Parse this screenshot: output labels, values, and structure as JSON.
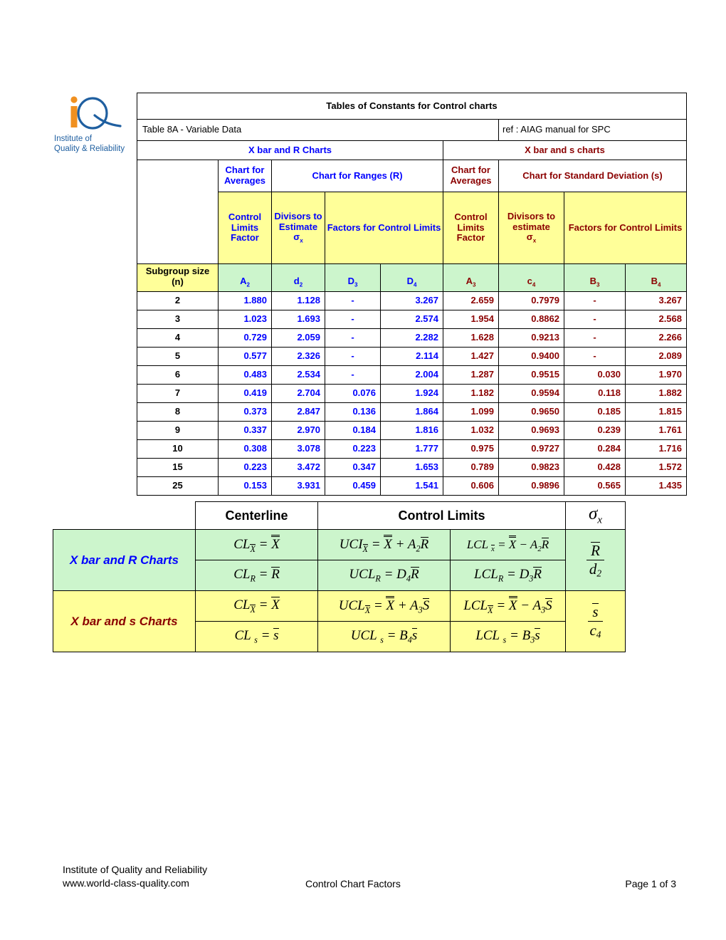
{
  "logo": {
    "caption_line1": "Institute of",
    "caption_line2": "Quality & Reliability",
    "mark_letters": "iQ",
    "color_orange": "#F09020",
    "color_blue": "#1F5FA0"
  },
  "header": {
    "title": "Tables of Constants for Control charts",
    "subtitle": "Table 8A - Variable Data",
    "reference": "ref : AIAG manual for SPC",
    "group_left": "X bar and R Charts",
    "group_right": "X bar and s charts",
    "color_blue": "#0000FF",
    "color_red": "#8B0000",
    "bg_yellow": "#FFFF99",
    "bg_green": "#CCF5CC"
  },
  "columns": {
    "chart_for_averages_left": "Chart for Averages",
    "chart_for_ranges": "Chart for Ranges (R)",
    "chart_for_averages_right": "Chart for Averages",
    "chart_for_std_dev": "Chart for Standard Deviation (s)",
    "desc_a2": "Control Limits Factor",
    "desc_d2": "Divisors to Estimate",
    "desc_d2_sigma": "σx",
    "desc_d3d4": "Factors for Control Limits",
    "desc_a3": "Control Limits Factor",
    "desc_c4": "Divisors to estimate",
    "desc_c4_sigma": "σx",
    "desc_b3b4": "Factors for Control Limits",
    "subgroup_label_line1": "Subgroup size",
    "subgroup_label_line2": "(n)",
    "symbols": [
      "A2",
      "d2",
      "D3",
      "D4",
      "A3",
      "c4",
      "B3",
      "B4"
    ]
  },
  "table_data": {
    "headers": [
      "Subgroup size (n)",
      "A2",
      "d2",
      "D3",
      "D4",
      "A3",
      "c4",
      "B3",
      "B4"
    ],
    "rows": [
      {
        "n": "2",
        "A2": "1.880",
        "d2": "1.128",
        "D3": "-",
        "D4": "3.267",
        "A3": "2.659",
        "c4": "0.7979",
        "B3": "-",
        "B4": "3.267"
      },
      {
        "n": "3",
        "A2": "1.023",
        "d2": "1.693",
        "D3": "-",
        "D4": "2.574",
        "A3": "1.954",
        "c4": "0.8862",
        "B3": "-",
        "B4": "2.568"
      },
      {
        "n": "4",
        "A2": "0.729",
        "d2": "2.059",
        "D3": "-",
        "D4": "2.282",
        "A3": "1.628",
        "c4": "0.9213",
        "B3": "-",
        "B4": "2.266"
      },
      {
        "n": "5",
        "A2": "0.577",
        "d2": "2.326",
        "D3": "-",
        "D4": "2.114",
        "A3": "1.427",
        "c4": "0.9400",
        "B3": "-",
        "B4": "2.089"
      },
      {
        "n": "6",
        "A2": "0.483",
        "d2": "2.534",
        "D3": "-",
        "D4": "2.004",
        "A3": "1.287",
        "c4": "0.9515",
        "B3": "0.030",
        "B4": "1.970"
      },
      {
        "n": "7",
        "A2": "0.419",
        "d2": "2.704",
        "D3": "0.076",
        "D4": "1.924",
        "A3": "1.182",
        "c4": "0.9594",
        "B3": "0.118",
        "B4": "1.882"
      },
      {
        "n": "8",
        "A2": "0.373",
        "d2": "2.847",
        "D3": "0.136",
        "D4": "1.864",
        "A3": "1.099",
        "c4": "0.9650",
        "B3": "0.185",
        "B4": "1.815"
      },
      {
        "n": "9",
        "A2": "0.337",
        "d2": "2.970",
        "D3": "0.184",
        "D4": "1.816",
        "A3": "1.032",
        "c4": "0.9693",
        "B3": "0.239",
        "B4": "1.761"
      },
      {
        "n": "10",
        "A2": "0.308",
        "d2": "3.078",
        "D3": "0.223",
        "D4": "1.777",
        "A3": "0.975",
        "c4": "0.9727",
        "B3": "0.284",
        "B4": "1.716"
      },
      {
        "n": "15",
        "A2": "0.223",
        "d2": "3.472",
        "D3": "0.347",
        "D4": "1.653",
        "A3": "0.789",
        "c4": "0.9823",
        "B3": "0.428",
        "B4": "1.572"
      },
      {
        "n": "25",
        "A2": "0.153",
        "d2": "3.931",
        "D3": "0.459",
        "D4": "1.541",
        "A3": "0.606",
        "c4": "0.9896",
        "B3": "0.565",
        "B4": "1.435"
      }
    ]
  },
  "formulas": {
    "header_centerline": "Centerline",
    "header_control_limits": "Control Limits",
    "header_sigma": "σx",
    "row1_label": "X bar and R Charts",
    "row2_label": "X bar and s Charts",
    "xbar_r": {
      "cl_mean": "CL X̅̅ = X̅̅",
      "ucl_mean": "UCL X̅ = X̅̅ + A2 R̅",
      "lcl_mean": "LCL X̅ = X̅̅ − A2 R̅",
      "cl_range": "CL R = R̅",
      "ucl_range": "UCL R = D4 R̅",
      "lcl_range": "LCL R = D3 R̅",
      "sigma_estimate": "R̅ / d2"
    },
    "xbar_s": {
      "cl_mean": "CL X̅ = X̅̅",
      "ucl_mean": "UCL X̅ = X̅̅ + A3 S̅",
      "lcl_mean": "LCL X̅ = X̅̅ − A3 S̅",
      "cl_s": "CL s = s̅",
      "ucl_s": "UCL s = B4 s̅",
      "lcl_s": "LCL s = B3 s̅",
      "sigma_estimate": "s̅ / c4"
    }
  },
  "footer": {
    "org": "Institute of Quality and Reliability",
    "website": "www.world-class-quality.com",
    "doc_title": "Control Chart Factors",
    "page": "Page 1 of 3"
  }
}
